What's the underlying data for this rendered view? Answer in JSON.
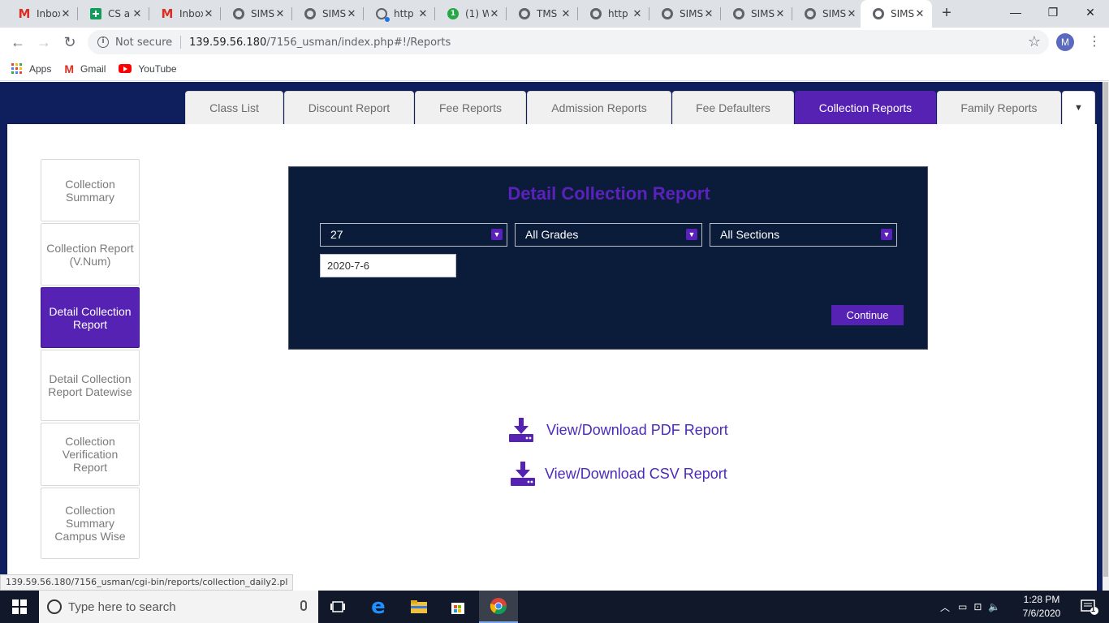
{
  "browser": {
    "tabs": [
      {
        "label": "Inbox",
        "icon": "gmail-icon"
      },
      {
        "label": "CS a",
        "icon": "sheets-icon"
      },
      {
        "label": "Inbox",
        "icon": "gmail-icon"
      },
      {
        "label": "SIMS",
        "icon": "globe-icon"
      },
      {
        "label": "SIMS",
        "icon": "globe-icon"
      },
      {
        "label": "http",
        "icon": "loading-icon"
      },
      {
        "label": "(1) W",
        "icon": "whatsapp-icon"
      },
      {
        "label": "TMS",
        "icon": "globe-icon"
      },
      {
        "label": "http",
        "icon": "globe-icon"
      },
      {
        "label": "SIMS",
        "icon": "globe-icon"
      },
      {
        "label": "SIMS",
        "icon": "globe-icon"
      },
      {
        "label": "SIMS",
        "icon": "globe-icon"
      },
      {
        "label": "SIMS",
        "icon": "globe-icon",
        "active": true
      }
    ],
    "security_label": "Not secure",
    "url_host": "139.59.56.180",
    "url_path": "/7156_usman/index.php#!/Reports",
    "profile_initial": "M",
    "bookmarks": [
      {
        "label": "Apps",
        "icon": "apps-grid-icon"
      },
      {
        "label": "Gmail",
        "icon": "gmail-icon"
      },
      {
        "label": "YouTube",
        "icon": "youtube-icon"
      }
    ],
    "status_url": "139.59.56.180/7156_usman/cgi-bin/reports/collection_daily2.pl"
  },
  "app": {
    "top_tabs": [
      {
        "label": "Class List"
      },
      {
        "label": "Discount Report"
      },
      {
        "label": "Fee Reports"
      },
      {
        "label": "Admission Reports"
      },
      {
        "label": "Fee Defaulters"
      },
      {
        "label": "Collection Reports",
        "active": true
      },
      {
        "label": "Family Reports"
      }
    ],
    "side_menu": [
      {
        "label": "Collection Summary"
      },
      {
        "label": "Collection Report (V.Num)"
      },
      {
        "label": "Detail Collection Report",
        "active": true
      },
      {
        "label": "Detail Collection Report Datewise"
      },
      {
        "label": "Collection Verification Report"
      },
      {
        "label": "Collection Summary Campus Wise"
      }
    ],
    "report": {
      "title": "Detail Collection Report",
      "campus_value": "27",
      "grade_value": "All Grades",
      "section_value": "All Sections",
      "date_value": "2020-7-6",
      "continue_label": "Continue"
    },
    "downloads": {
      "pdf_label": "View/Download PDF Report",
      "csv_label": "View/Download CSV Report"
    }
  },
  "taskbar": {
    "search_placeholder": "Type here to search",
    "time": "1:28 PM",
    "date": "7/6/2020",
    "notification_count": "1"
  },
  "colors": {
    "app_header_bg": "#0f1e5c",
    "accent_purple": "#5622b3",
    "report_panel_bg": "#0b1c3a",
    "link_purple": "#4b2bb8"
  }
}
